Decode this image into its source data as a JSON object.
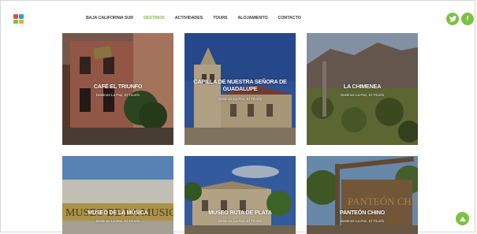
{
  "nav": {
    "items": [
      {
        "label": "BAJA CALIFORNIA SUR",
        "active": false
      },
      {
        "label": "DESTINOS",
        "active": true
      },
      {
        "label": "ACTIVIDADES",
        "active": false
      },
      {
        "label": "TOURS",
        "active": false
      },
      {
        "label": "ALOJAMIENTO",
        "active": false
      },
      {
        "label": "CONTACTO",
        "active": false
      }
    ]
  },
  "social": {
    "twitter_icon": "twitter-icon",
    "facebook_icon": "facebook-icon",
    "twitter": "🐦",
    "facebook": "f"
  },
  "colors": {
    "accent": "#7cc143",
    "nav_text": "#3b3b3b"
  },
  "cards": [
    {
      "title": "CAFÉ EL TRIUNFO",
      "subtitle": "Destinos La Paz, El Triunfo"
    },
    {
      "title": "CAPILLA DE NUESTRA SEÑORA DE GUADALUPE",
      "subtitle": "Destinos La Paz, El Triunfo"
    },
    {
      "title": "LA CHIMENEA",
      "subtitle": "Destinos La Paz, El Triunfo"
    },
    {
      "title": "MUSEO DE LA MÚSICA",
      "subtitle": "Destinos La Paz, El Triunfo"
    },
    {
      "title": "MUSEO RUTA DE PLATA",
      "subtitle": "Destinos La Paz, El Triunfo"
    },
    {
      "title": "PANTEÓN CHINO",
      "subtitle": "Destinos La Paz, El Triunfo"
    }
  ],
  "images": {
    "museo_sign": "MUSEO DE LA MUSICA",
    "panteon_sign": "PANTEÓN CHINO"
  }
}
